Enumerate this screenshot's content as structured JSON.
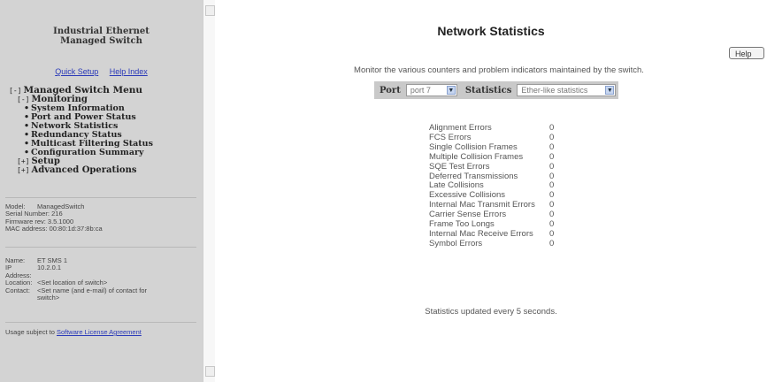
{
  "sidebar": {
    "title_line1": "Industrial Ethernet",
    "title_line2": "Managed Switch",
    "quick_setup": "Quick Setup",
    "help_index": "Help Index",
    "menu": {
      "root_toggle": "[-]",
      "root_label": "Managed Switch Menu",
      "monitoring_toggle": "[-]",
      "monitoring_label": "Monitoring",
      "items": [
        "System Information",
        "Port and Power Status",
        "Network Statistics",
        "Redundancy Status",
        "Multicast Filtering Status",
        "Configuration Summary"
      ],
      "setup_toggle": "[+]",
      "setup_label": "Setup",
      "advanced_toggle": "[+]",
      "advanced_label": "Advanced Operations"
    },
    "device": {
      "model_key": "Model:",
      "model_value": "ManagedSwitch",
      "serial": "Serial Number: 216",
      "firmware": "Firmware rev: 3.5.1000",
      "mac": "MAC address: 00:80:1d:37:8b:ca"
    },
    "contact": {
      "name_key": "Name:",
      "name_value": "ET SMS 1",
      "ip_key": "IP",
      "ip_key2": "Address:",
      "ip_value": "10.2.0.1",
      "location_key": "Location:",
      "location_value": "<Set location of switch>",
      "contact_key": "Contact:",
      "contact_value": "<Set name (and e-mail) of contact for switch>"
    },
    "license_prefix": "Usage subject to",
    "license_link": "Software License Agreement"
  },
  "main": {
    "title": "Network Statistics",
    "help_button": "Help",
    "description": "Monitor the various counters and problem indicators maintained by the switch.",
    "port_label": "Port",
    "port_selected": "port 7",
    "statistics_label": "Statistics",
    "statistics_selected": "Ether-like statistics",
    "stats": [
      {
        "label": "Alignment Errors",
        "value": "0"
      },
      {
        "label": "FCS Errors",
        "value": "0"
      },
      {
        "label": "Single Collision Frames",
        "value": "0"
      },
      {
        "label": "Multiple Collision Frames",
        "value": "0"
      },
      {
        "label": "SQE Test Errors",
        "value": "0"
      },
      {
        "label": "Deferred Transmissions",
        "value": "0"
      },
      {
        "label": "Late Collisions",
        "value": "0"
      },
      {
        "label": "Excessive Collisions",
        "value": "0"
      },
      {
        "label": "Internal Mac Transmit Errors",
        "value": "0"
      },
      {
        "label": "Carrier Sense Errors",
        "value": "0"
      },
      {
        "label": "Frame Too Longs",
        "value": "0"
      },
      {
        "label": "Internal Mac Receive Errors",
        "value": "0"
      },
      {
        "label": "Symbol Errors",
        "value": "0"
      }
    ],
    "footer": "Statistics updated every 5 seconds."
  }
}
